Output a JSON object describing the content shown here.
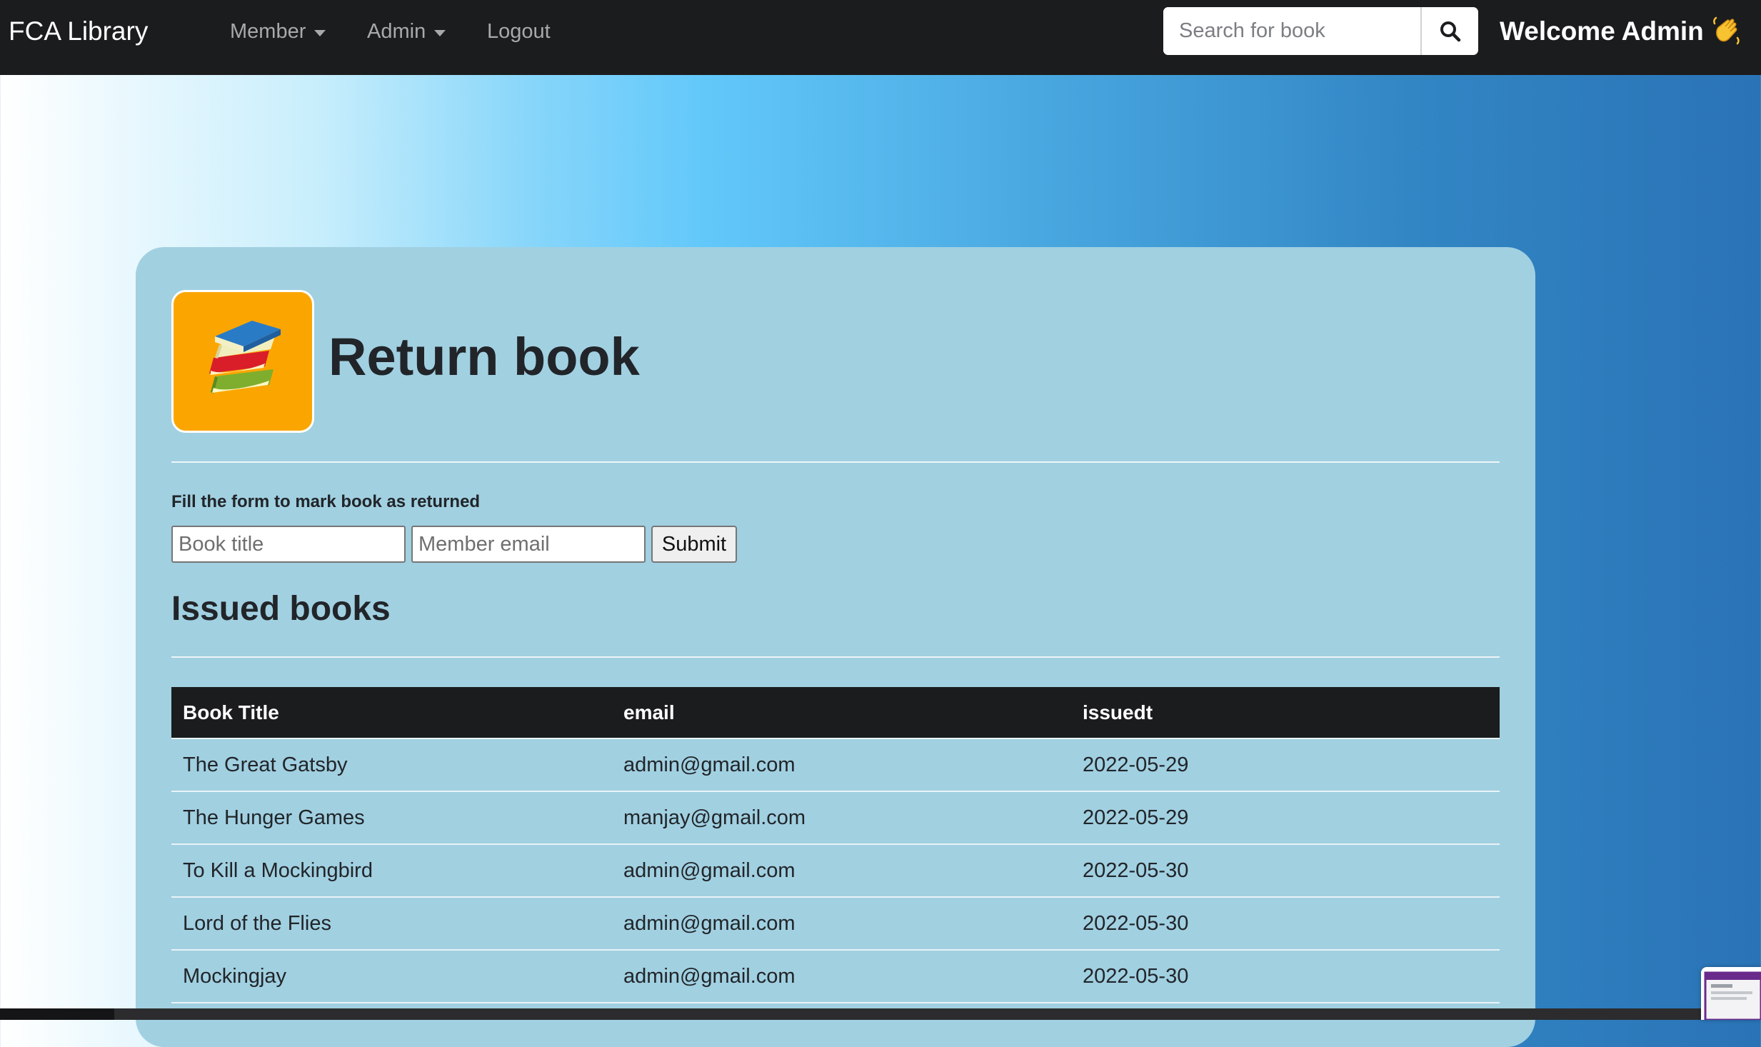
{
  "navbar": {
    "brand": "FCA Library",
    "items": [
      {
        "label": "Member",
        "has_dropdown": true
      },
      {
        "label": "Admin",
        "has_dropdown": true
      },
      {
        "label": "Logout",
        "has_dropdown": false
      }
    ],
    "search": {
      "placeholder": "Search for book",
      "value": "",
      "icon": "search-icon"
    },
    "welcome": "Welcome Admin",
    "welcome_emoji": "waving-hand-icon"
  },
  "page": {
    "logo_icon": "stacked-books-icon",
    "title": "Return book",
    "form": {
      "hint": "Fill the form to mark book as returned",
      "book_title_placeholder": "Book title",
      "member_email_placeholder": "Member email",
      "submit_label": "Submit"
    },
    "issued": {
      "title": "Issued books",
      "columns": [
        "Book Title",
        "email",
        "issuedt"
      ],
      "rows": [
        [
          "The Great Gatsby",
          "admin@gmail.com",
          "2022-05-29"
        ],
        [
          "The Hunger Games",
          "manjay@gmail.com",
          "2022-05-29"
        ],
        [
          "To Kill a Mockingbird",
          "admin@gmail.com",
          "2022-05-30"
        ],
        [
          "Lord of the Flies",
          "admin@gmail.com",
          "2022-05-30"
        ],
        [
          "Mockingjay",
          "admin@gmail.com",
          "2022-05-30"
        ]
      ]
    }
  },
  "colors": {
    "navbar_bg": "#1b1c1e",
    "card_bg": "#a1d0e1",
    "logo_bg": "#fba600",
    "table_header_bg": "#1b1c1e"
  }
}
